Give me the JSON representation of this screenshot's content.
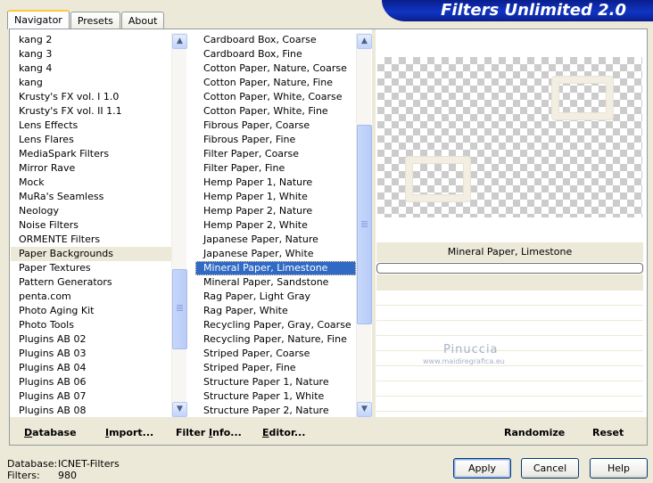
{
  "window": {
    "title": "Filters Unlimited 2.0"
  },
  "tabs": [
    {
      "label": "Navigator",
      "active": true
    },
    {
      "label": "Presets",
      "active": false
    },
    {
      "label": "About",
      "active": false
    }
  ],
  "categories": {
    "items": [
      "kang 2",
      "kang 3",
      "kang 4",
      "kang",
      "Krusty's FX vol. I 1.0",
      "Krusty's FX vol. II 1.1",
      "Lens Effects",
      "Lens Flares",
      "MediaSpark Filters",
      "Mirror Rave",
      "Mock",
      "MuRa's Seamless",
      "Neology",
      "Noise Filters",
      "ORMENTE Filters",
      "Paper Backgrounds",
      "Paper Textures",
      "Pattern Generators",
      "penta.com",
      "Photo Aging Kit",
      "Photo Tools",
      "Plugins AB 02",
      "Plugins AB 03",
      "Plugins AB 04",
      "Plugins AB 06",
      "Plugins AB 07",
      "Plugins AB 08"
    ],
    "selected": "Paper Backgrounds"
  },
  "filters": {
    "items": [
      "Cardboard Box, Coarse",
      "Cardboard Box, Fine",
      "Cotton Paper, Nature, Coarse",
      "Cotton Paper, Nature, Fine",
      "Cotton Paper, White, Coarse",
      "Cotton Paper, White, Fine",
      "Fibrous Paper, Coarse",
      "Fibrous Paper, Fine",
      "Filter Paper, Coarse",
      "Filter Paper, Fine",
      "Hemp Paper 1, Nature",
      "Hemp Paper 1, White",
      "Hemp Paper 2, Nature",
      "Hemp Paper 2, White",
      "Japanese Paper, Nature",
      "Japanese Paper, White",
      "Mineral Paper, Limestone",
      "Mineral Paper, Sandstone",
      "Rag Paper, Light Gray",
      "Rag Paper, White",
      "Recycling Paper, Gray, Coarse",
      "Recycling Paper, Nature, Fine",
      "Striped Paper, Coarse",
      "Striped Paper, Fine",
      "Structure Paper 1, Nature",
      "Structure Paper 1, White",
      "Structure Paper 2, Nature"
    ],
    "selected": "Mineral Paper, Limestone"
  },
  "preview": {
    "filter_name": "Mineral Paper, Limestone"
  },
  "watermark": {
    "name": "Pinuccia",
    "url": "www.maidiregrafica.eu"
  },
  "toolbar": {
    "database": {
      "key": "D",
      "rest": "atabase"
    },
    "import": {
      "key": "I",
      "rest": "mport..."
    },
    "filter_info": {
      "pre": "Filter ",
      "key": "I",
      "rest": "nfo..."
    },
    "editor": {
      "key": "E",
      "rest": "ditor..."
    },
    "randomize": "Randomize",
    "reset": "Reset"
  },
  "status": {
    "database_label": "Database:",
    "database_value": "ICNET-Filters",
    "filters_label": "Filters:",
    "filters_value": "980"
  },
  "buttons": {
    "apply": "Apply",
    "cancel": "Cancel",
    "help": "Help"
  },
  "colors": {
    "selection": "#316AC5",
    "banner": "#0A1E8C",
    "face": "#ECE9D8"
  }
}
